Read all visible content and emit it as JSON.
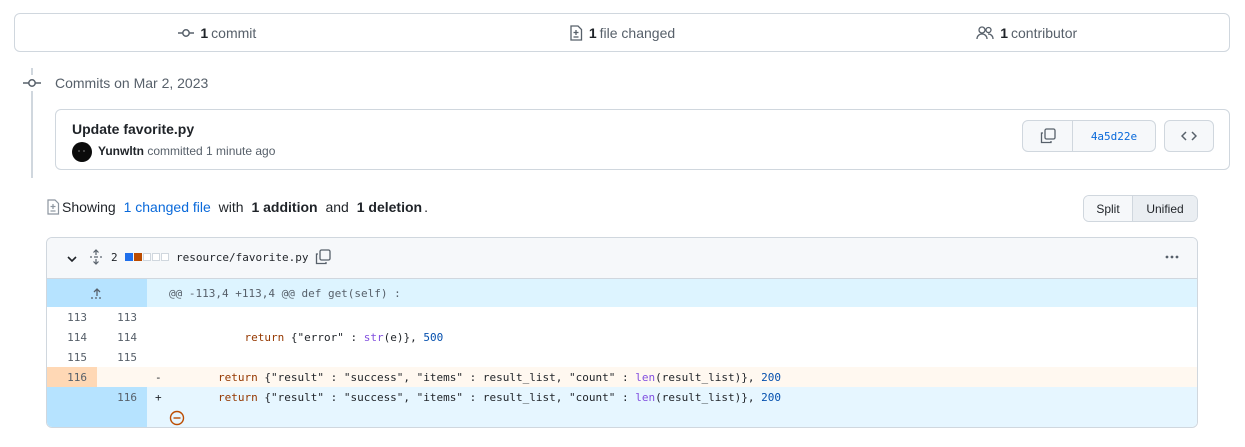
{
  "summary": {
    "commits_count": "1",
    "commits_label": "commit",
    "files_count": "1",
    "files_label": "file changed",
    "contributors_count": "1",
    "contributors_label": "contributor"
  },
  "timeline": {
    "heading": "Commits on Mar 2, 2023"
  },
  "commit": {
    "title": "Update favorite.py",
    "author": "Yunwltn",
    "action": "committed 1 minute ago",
    "sha": "4a5d22e"
  },
  "showing": {
    "prefix": "Showing",
    "changed_files": "1 changed file",
    "mid": "with",
    "additions": "1 addition",
    "and": "and",
    "deletions": "1 deletion",
    "suffix": "."
  },
  "view_toggle": {
    "split": "Split",
    "unified": "Unified",
    "selected": "Unified"
  },
  "file": {
    "change_count": "2",
    "path": "resource/favorite.py",
    "diffstat": [
      "add",
      "delete",
      "neutral",
      "neutral",
      "neutral"
    ],
    "hunk_header": "@@ -113,4 +113,4 @@ def get(self) :",
    "lines": [
      {
        "type": "context",
        "old": "113",
        "new": "113",
        "sign": "",
        "pre": "",
        "kw": "",
        "mid": "",
        "fn": "",
        "args": "",
        "num": "",
        "post": ""
      },
      {
        "type": "context",
        "old": "114",
        "new": "114",
        "sign": "",
        "pre": "            ",
        "kw": "return",
        "mid": " {\"error\" : ",
        "fn": "str",
        "args": "(e)}, ",
        "num": "500",
        "post": ""
      },
      {
        "type": "context",
        "old": "115",
        "new": "115",
        "sign": "",
        "pre": "",
        "kw": "",
        "mid": "",
        "fn": "",
        "args": "",
        "num": "",
        "post": ""
      },
      {
        "type": "del",
        "old": "116",
        "new": "",
        "sign": "-",
        "pre": "        ",
        "kw": "return",
        "mid": " {\"result\" : \"success\", \"items\" : result_list, \"count\" : ",
        "fn": "len",
        "args": "(result_list)}, ",
        "num": "200",
        "post": ""
      },
      {
        "type": "add",
        "old": "",
        "new": "116",
        "sign": "+",
        "pre": "        ",
        "kw": "return",
        "mid": " {\"result\" : \"success\", \"items\" : result_list, \"count\" : ",
        "fn": "len",
        "args": "(result_list)}, ",
        "num": "200",
        "post": ""
      }
    ]
  },
  "colors": {
    "accent": "#0969da",
    "add_gutter": "#b6e3ff",
    "del_gutter": "#ffd8b5",
    "neutral": "#d0d7de"
  }
}
